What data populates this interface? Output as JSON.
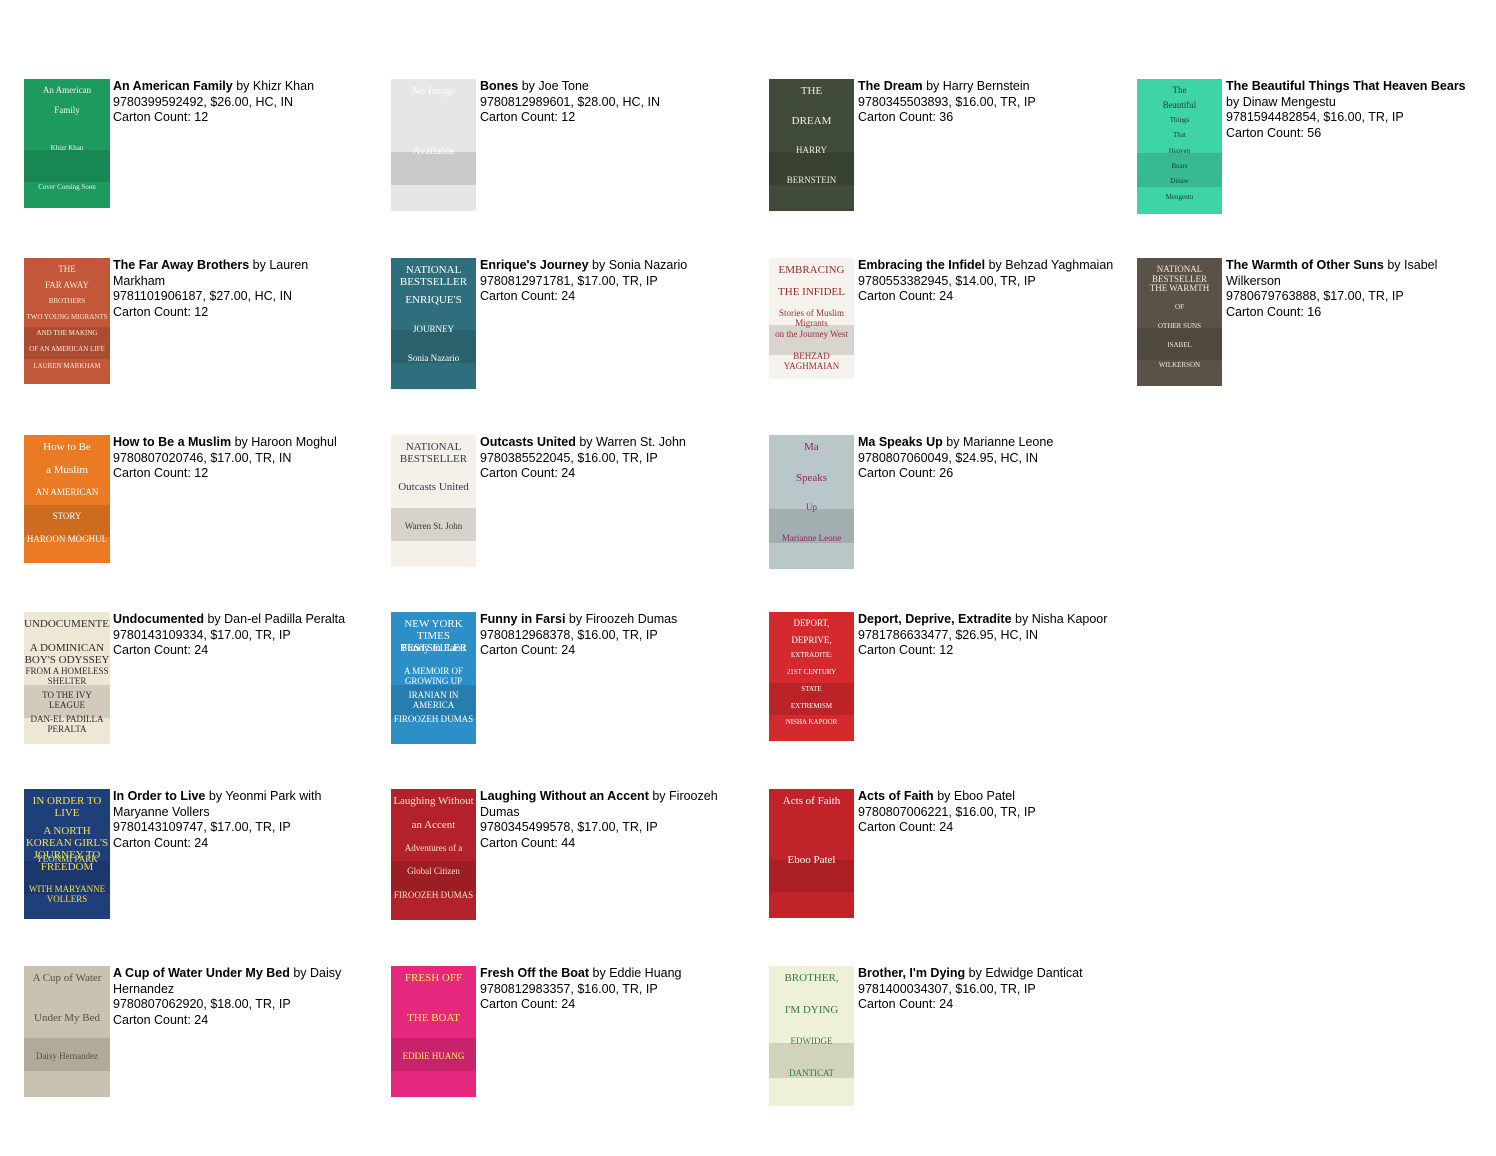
{
  "books": [
    {
      "title": "An American Family",
      "by": "by",
      "author": "Khizr Khan",
      "details": "9780399592492, $26.00, HC, IN",
      "carton": "Carton Count: 12",
      "cover": {
        "bg": "#1d9a5e",
        "fg": "#e8f5ee",
        "lines": [
          "An American",
          "Family",
          "",
          "Khizr Khan",
          "",
          "Cover Coming Soon"
        ]
      }
    },
    {
      "title": "Bones",
      "by": "by",
      "author": "Joe Tone",
      "details": "9780812989601, $28.00, HC, IN",
      "carton": "Carton Count: 12",
      "cover": {
        "bg": "#e6e6e6",
        "fg": "#ffffff",
        "lines": [
          "No Image",
          "Available"
        ]
      }
    },
    {
      "title": "The Dream",
      "by": "by",
      "author": "Harry Bernstein",
      "details": "9780345503893, $16.00, TR, IP",
      "carton": "Carton Count: 36",
      "cover": {
        "bg": "#3f4a3a",
        "fg": "#f2ede0",
        "lines": [
          "THE",
          "DREAM",
          "HARRY",
          "BERNSTEIN"
        ]
      }
    },
    {
      "title": "The Beautiful Things That Heaven Bears",
      "by": "by",
      "author": "Dinaw Mengestu",
      "details": "9781594482854, $16.00, TR, IP",
      "carton": "Carton Count: 56",
      "cover": {
        "bg": "#3fd4a6",
        "fg": "#1b3c34",
        "lines": [
          "The",
          "Beautiful",
          "Things",
          "That",
          "Heaven",
          "Bears",
          "Dinaw",
          "Mengestu"
        ]
      }
    },
    {
      "title": "The Far Away Brothers",
      "by": "by",
      "author": "Lauren Markham",
      "details": "9781101906187, $27.00, HC, IN",
      "carton": "Carton Count: 12",
      "cover": {
        "bg": "#c2573a",
        "fg": "#fbe9dc",
        "lines": [
          "THE",
          "FAR AWAY",
          "BROTHERS",
          "TWO YOUNG MIGRANTS",
          "AND THE MAKING",
          "OF AN AMERICAN LIFE",
          "LAUREN MARKHAM"
        ]
      }
    },
    {
      "title": "Enrique's Journey",
      "by": "by",
      "author": "Sonia Nazario",
      "details": "9780812971781, $17.00, TR, IP",
      "carton": "Carton Count: 24",
      "cover": {
        "bg": "#2f6f7d",
        "fg": "#ffffff",
        "lines": [
          "NATIONAL BESTSELLER",
          "ENRIQUE'S",
          "JOURNEY",
          "Sonia Nazario"
        ]
      }
    },
    {
      "title": "Embracing the Infidel",
      "by": "by",
      "author": "Behzad Yaghmaian",
      "details": "9780553382945, $14.00, TR, IP",
      "carton": "Carton Count: 24",
      "cover": {
        "bg": "#f6f3ee",
        "fg": "#9b2b2b",
        "lines": [
          "EMBRACING",
          "THE INFIDEL",
          "Stories of Muslim Migrants",
          "on the Journey West",
          "BEHZAD YAGHMAIAN"
        ]
      }
    },
    {
      "title": "The Warmth of Other Suns",
      "by": "by",
      "author": "Isabel Wilkerson",
      "details": "9780679763888, $17.00, TR, IP",
      "carton": "Carton Count: 16",
      "cover": {
        "bg": "#5a5246",
        "fg": "#f0ead8",
        "lines": [
          "NATIONAL BESTSELLER",
          "THE WARMTH",
          "OF",
          "OTHER SUNS",
          "ISABEL",
          "WILKERSON"
        ]
      }
    },
    {
      "title": "How to Be a Muslim",
      "by": "by",
      "author": "Haroon Moghul",
      "details": "9780807020746, $17.00, TR, IN",
      "carton": "Carton Count: 12",
      "cover": {
        "bg": "#ea7a23",
        "fg": "#ffffff",
        "lines": [
          "How to Be",
          "a Muslim",
          "AN AMERICAN",
          "STORY",
          "HAROON MOGHUL"
        ]
      }
    },
    {
      "title": "Outcasts United",
      "by": "by",
      "author": "Warren St. John",
      "details": "9780385522045, $16.00, TR, IP",
      "carton": "Carton Count: 24",
      "cover": {
        "bg": "#f5f1e8",
        "fg": "#2f3a4a",
        "lines": [
          "NATIONAL BESTSELLER",
          "Outcasts United",
          "Warren St. John"
        ]
      }
    },
    {
      "title": "Ma Speaks Up",
      "by": "by",
      "author": "Marianne Leone",
      "details": "9780807060049, $24.95, HC, IN",
      "carton": "Carton Count: 26",
      "cover": {
        "bg": "#b9c7c9",
        "fg": "#8a2a6a",
        "lines": [
          "Ma",
          "Speaks",
          "Up",
          "Marianne Leone"
        ]
      }
    },
    {
      "title": "Undocumented",
      "by": "by",
      "author": "Dan-el Padilla Peralta",
      "details": "9780143109334, $17.00, TR, IP",
      "carton": "Carton Count: 24",
      "cover": {
        "bg": "#efe7d6",
        "fg": "#2c2c2c",
        "lines": [
          "UNDOCUMENTED",
          "A DOMINICAN BOY'S ODYSSEY",
          "FROM A HOMELESS SHELTER",
          "TO THE IVY LEAGUE",
          "DAN-EL PADILLA PERALTA"
        ]
      }
    },
    {
      "title": "Funny in Farsi",
      "by": "by",
      "author": "Firoozeh Dumas",
      "details": "9780812968378, $16.00, TR, IP",
      "carton": "Carton Count: 24",
      "cover": {
        "bg": "#2d8fc7",
        "fg": "#ffffff",
        "lines": [
          "NEW YORK TIMES BESTSELLER",
          "Funny in Farsi",
          "A MEMOIR OF GROWING UP",
          "IRANIAN IN AMERICA",
          "FIROOZEH DUMAS"
        ]
      }
    },
    {
      "title": "Deport, Deprive, Extradite",
      "by": "by",
      "author": "Nisha Kapoor",
      "details": "9781786633477, $26.95, HC, IN",
      "carton": "Carton Count: 12",
      "cover": {
        "bg": "#d42a2e",
        "fg": "#ffffff",
        "lines": [
          "DEPORT,",
          "DEPRIVE,",
          "EXTRADITE:",
          "21ST CENTURY",
          "STATE",
          "EXTREMISM",
          "NISHA KAPOOR"
        ]
      }
    },
    {
      "title": "In Order to Live",
      "by": "by",
      "author": "Yeonmi Park with Maryanne Vollers",
      "details": "9780143109747, $17.00, TR, IP",
      "carton": "Carton Count: 24",
      "cover": {
        "bg": "#1f3f7a",
        "fg": "#f4e04d",
        "lines": [
          "IN ORDER TO LIVE",
          "A NORTH KOREAN GIRL'S JOURNEY TO FREEDOM",
          "YEONMI PARK",
          "WITH MARYANNE VOLLERS"
        ]
      }
    },
    {
      "title": "Laughing Without an Accent",
      "by": "by",
      "author": "Firoozeh Dumas",
      "details": "9780345499578, $17.00, TR, IP",
      "carton": "Carton Count: 44",
      "cover": {
        "bg": "#b3212a",
        "fg": "#f7e6c4",
        "lines": [
          "Laughing Without",
          "an Accent",
          "Adventures of a",
          "Global Citizen",
          "FIROOZEH DUMAS"
        ]
      }
    },
    {
      "title": "Acts of Faith",
      "by": "by",
      "author": "Eboo Patel",
      "details": "9780807006221, $16.00, TR, IP",
      "carton": "Carton Count: 24",
      "cover": {
        "bg": "#c2232a",
        "fg": "#ffffff",
        "lines": [
          "Acts of Faith",
          "Eboo Patel"
        ]
      }
    },
    {
      "title": "A Cup of Water Under My Bed",
      "by": "by",
      "author": "Daisy Hernandez",
      "details": "9780807062920, $18.00, TR, IP",
      "carton": "Carton Count: 24",
      "cover": {
        "bg": "#c9c2b0",
        "fg": "#5a4f3e",
        "lines": [
          "A Cup of Water",
          "Under My Bed",
          "Daisy Hernandez"
        ]
      }
    },
    {
      "title": "Fresh Off the Boat",
      "by": "by",
      "author": "Eddie Huang",
      "details": "9780812983357, $16.00, TR, IP",
      "carton": "Carton Count: 24",
      "cover": {
        "bg": "#e5277d",
        "fg": "#fff35a",
        "lines": [
          "FRESH OFF",
          "THE BOAT",
          "EDDIE HUANG"
        ]
      }
    },
    {
      "title": "Brother, I'm Dying",
      "by": "by",
      "author": "Edwidge Danticat",
      "details": "9781400034307, $16.00, TR, IP",
      "carton": "Carton Count: 24",
      "cover": {
        "bg": "#eef1d8",
        "fg": "#2f7a4a",
        "lines": [
          "BROTHER,",
          "I'M DYING",
          "EDWIDGE",
          "DANTICAT"
        ]
      }
    }
  ]
}
